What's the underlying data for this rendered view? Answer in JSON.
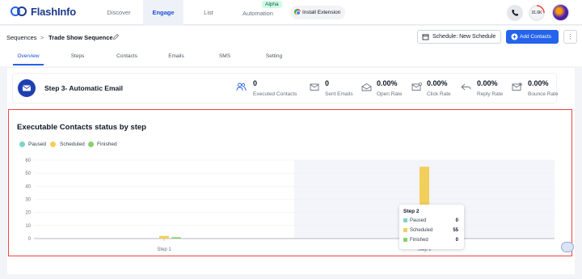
{
  "brand": {
    "name": "FlashInfo"
  },
  "nav": {
    "items": [
      {
        "label": "Discover"
      },
      {
        "label": "Engage"
      },
      {
        "label": "List"
      },
      {
        "label": "Automation"
      }
    ],
    "alpha_badge": "Alpha",
    "install_extension": "Install Extension",
    "credits": "31.6K"
  },
  "breadcrumb": {
    "root": "Sequences",
    "separator": ">",
    "current": "Trade Show Sequence"
  },
  "actions": {
    "schedule": "Schedule: New Schedule",
    "add_contacts": "Add Contacts",
    "more": "⋮"
  },
  "tabs": [
    {
      "label": "Overview"
    },
    {
      "label": "Steps"
    },
    {
      "label": "Contacts"
    },
    {
      "label": "Emails"
    },
    {
      "label": "SMS"
    },
    {
      "label": "Setting"
    }
  ],
  "step": {
    "title": "Step 3- Automatic Email",
    "stats": [
      {
        "value": "0",
        "label": "Executed Contacts",
        "icon": "users-icon"
      },
      {
        "value": "0",
        "label": "Sent Emails",
        "icon": "mail-sent-icon"
      },
      {
        "value": "0.00%",
        "label": "Open Rate",
        "icon": "mail-open-icon"
      },
      {
        "value": "0.00%",
        "label": "Click Rate",
        "icon": "mail-click-icon"
      },
      {
        "value": "0.00%",
        "label": "Reply Rate",
        "icon": "reply-icon"
      },
      {
        "value": "0.00%",
        "label": "Bounce Rate",
        "icon": "mail-bounce-icon"
      }
    ]
  },
  "chart_data": {
    "type": "bar",
    "title": "Executable Contacts status by step",
    "categories": [
      "Step 1",
      "Step 2"
    ],
    "series": [
      {
        "name": "Paused",
        "color": "#7dd3c8",
        "values": [
          0,
          0
        ]
      },
      {
        "name": "Scheduled",
        "color": "#f2cf5b",
        "values": [
          2,
          55
        ]
      },
      {
        "name": "Finished",
        "color": "#8bcf6b",
        "values": [
          1,
          0
        ]
      }
    ],
    "yticks": [
      "0",
      "10",
      "20",
      "30",
      "40",
      "50",
      "60"
    ],
    "ylim": [
      0,
      60
    ],
    "legend": "top-left",
    "highlighted_category": "Step 2"
  },
  "tooltip": {
    "title": "Step 2",
    "rows": [
      {
        "label": "Paused",
        "value": "0",
        "color": "#7dd3c8"
      },
      {
        "label": "Scheduled",
        "value": "55",
        "color": "#f2cf5b"
      },
      {
        "label": "Finished",
        "value": "0",
        "color": "#8bcf6b"
      }
    ]
  },
  "colors": {
    "accent": "#2563eb",
    "highlight_border": "#ef4444",
    "brand_dark": "#1e3a8a"
  }
}
